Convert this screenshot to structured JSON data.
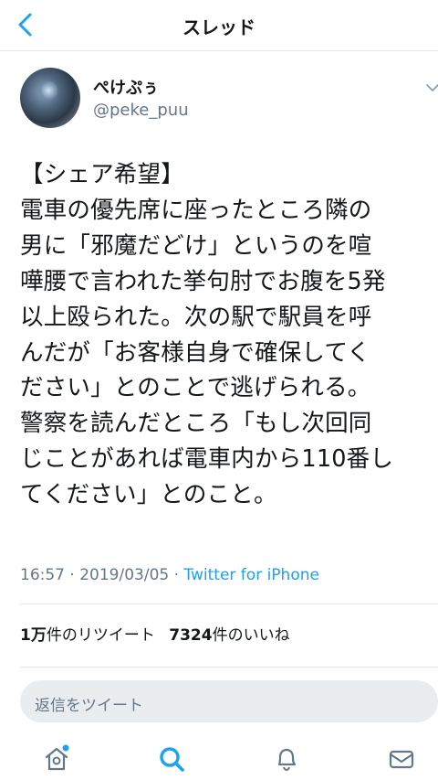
{
  "header": {
    "title": "スレッド"
  },
  "author": {
    "display_name": "ぺけぷぅ",
    "handle": "@peke_puu"
  },
  "tweet": {
    "text": "【シェア希望】\n電車の優先席に座ったところ隣の\n男に「邪魔だどけ」というのを喧\n嘩腰で言われた挙句肘でお腹を5発\n以上殴られた。次の駅で駅員を呼\nんだが「お客様自身で確保してく\nださい」とのことで逃げられる。\n警察を読んだところ「もし次回同\nじことがあれば電車内から110番し\nてください」とのこと。",
    "time": "16:57",
    "separator1": " · ",
    "date": "2019/03/05",
    "separator2": " · ",
    "source": "Twitter for iPhone"
  },
  "stats": {
    "retweets_count": "1万",
    "retweets_label": "件のリツイート",
    "likes_count": "7324",
    "likes_label": "件のいいね"
  },
  "reply": {
    "placeholder": "返信をツイート"
  },
  "tabbar": {
    "items": [
      {
        "icon": "home-icon"
      },
      {
        "icon": "search-icon"
      },
      {
        "icon": "bell-icon"
      },
      {
        "icon": "mail-icon"
      }
    ]
  },
  "colors": {
    "accent": "#1da1f2",
    "secondary_text": "#657786",
    "divider": "#e1e8ed",
    "reply_bg": "#e9edf0"
  }
}
